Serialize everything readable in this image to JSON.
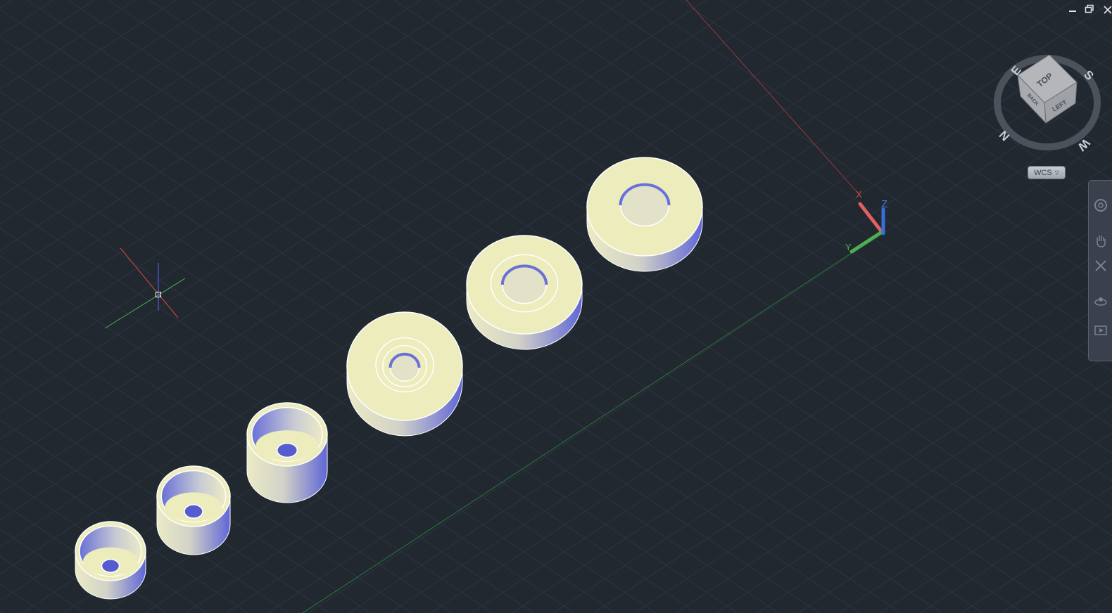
{
  "window": {
    "minimize_icon": "minimize-icon",
    "restore_icon": "restore-icon",
    "close_icon": "close-icon"
  },
  "viewcube": {
    "faces": {
      "top": "TOP",
      "left": "LEFT",
      "back": "BACK"
    },
    "compass": {
      "north": "N",
      "south": "S",
      "east": "E",
      "west": "W"
    }
  },
  "ucs_icon": {
    "x_label": "X",
    "y_label": "Y",
    "z_label": "Z"
  },
  "wcs_menu": {
    "label": "WCS",
    "caret_icon": "chevron-down-icon"
  },
  "navigation_bar": {
    "tools": [
      "steering-wheel-icon",
      "pan-icon",
      "zoom-icon",
      "orbit-icon",
      "showmotion-icon"
    ]
  },
  "colors": {
    "background": "#212830",
    "grid_line": "#2e3844",
    "solid_top": "#ececbd",
    "solid_side_light": "#e8e8c4",
    "solid_side_dark": "#6a6fd8",
    "edge": "#ffffff",
    "x_axis": "#d94848",
    "y_axis": "#4caf50",
    "z_axis": "#3b6fd8"
  }
}
